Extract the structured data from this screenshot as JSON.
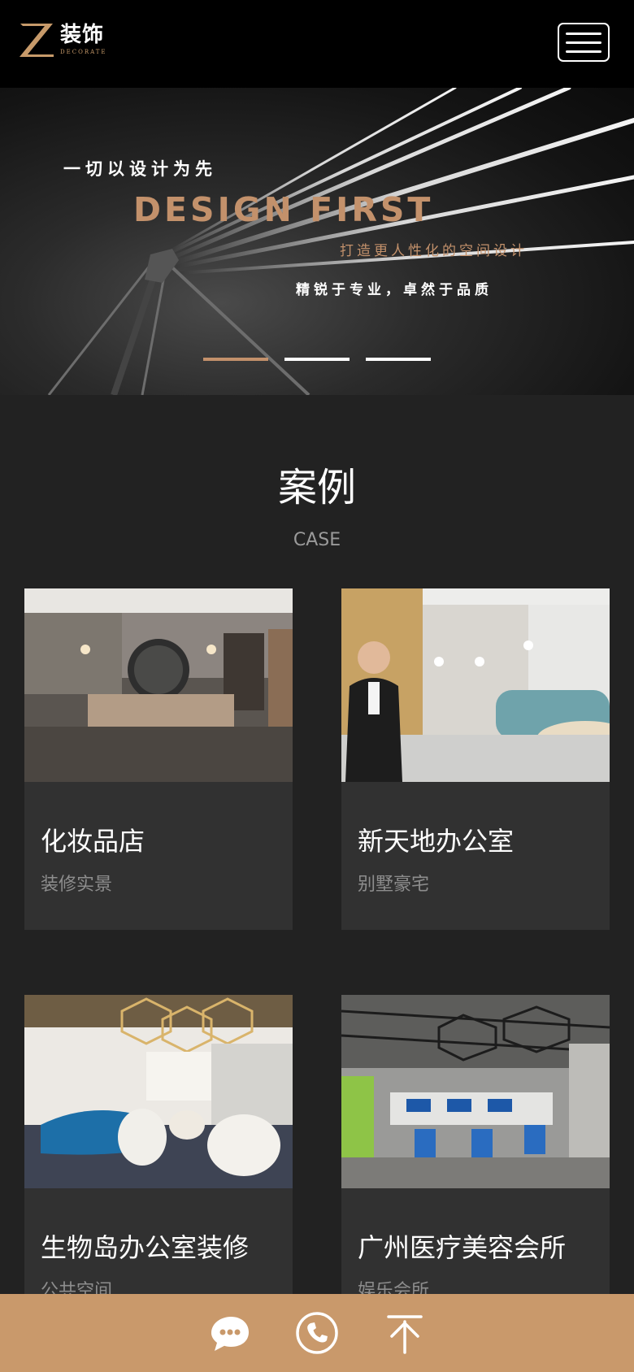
{
  "header": {
    "logo_cn": "装饰",
    "logo_en": "DECORATE",
    "menu_icon": "hamburger-menu-icon"
  },
  "banner": {
    "line1": "一切以设计为先",
    "line2": "DESIGN FIRST",
    "line3": "打造更人性化的空间设计",
    "line4": "精锐于专业，卓然于品质",
    "slides": 3,
    "active_slide": 1
  },
  "section": {
    "title": "案例",
    "subtitle": "CASE"
  },
  "cases": [
    {
      "title": "化妆品店",
      "category": "装修实景"
    },
    {
      "title": "新天地办公室",
      "category": "别墅豪宅"
    },
    {
      "title": "生物岛办公室装修",
      "category": "公共空间"
    },
    {
      "title": "广州医疗美容会所",
      "category": "娱乐会所"
    }
  ],
  "footer": {
    "icons": [
      "chat-icon",
      "phone-icon",
      "back-to-top-icon"
    ]
  },
  "colors": {
    "accent": "#c9996b",
    "background": "#222222",
    "card": "#313131"
  }
}
